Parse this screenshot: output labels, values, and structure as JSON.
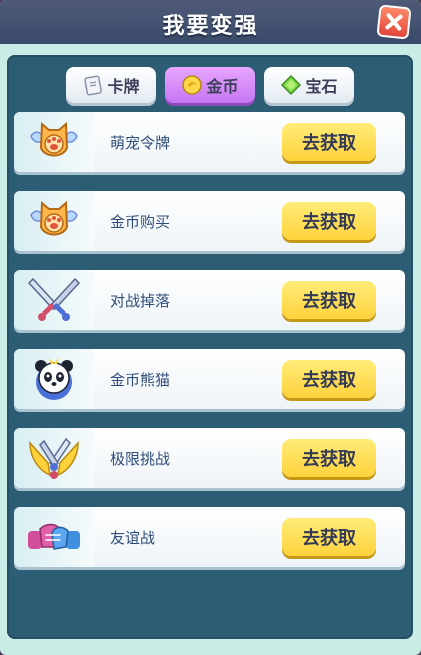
{
  "header": {
    "title": "我要变强"
  },
  "tabs": [
    {
      "label": "卡牌",
      "icon": "card-icon",
      "active": false
    },
    {
      "label": "金币",
      "icon": "coin-icon",
      "active": true
    },
    {
      "label": "宝石",
      "icon": "gem-icon",
      "active": false
    }
  ],
  "rows": [
    {
      "label": "萌宠令牌",
      "icon": "paw-badge-icon",
      "button": "去获取"
    },
    {
      "label": "金币购买",
      "icon": "paw-badge-icon",
      "button": "去获取"
    },
    {
      "label": "对战掉落",
      "icon": "crossed-swords-icon",
      "button": "去获取"
    },
    {
      "label": "金币熊猫",
      "icon": "panda-icon",
      "button": "去获取"
    },
    {
      "label": "极限挑战",
      "icon": "winged-sword-icon",
      "button": "去获取"
    },
    {
      "label": "友谊战",
      "icon": "handshake-icon",
      "button": "去获取"
    }
  ],
  "colors": {
    "accent_button": "#ffd23c",
    "active_tab": "#c476f2",
    "panel": "#2c5d74",
    "close": "#e2453a"
  }
}
